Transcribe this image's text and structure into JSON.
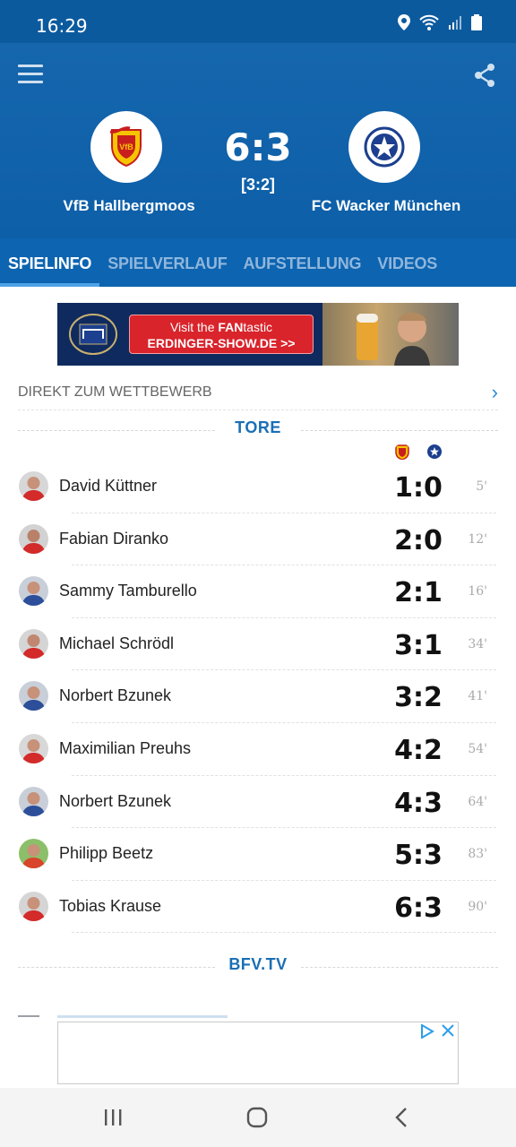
{
  "status_bar": {
    "time": "16:29"
  },
  "match": {
    "home_team": "VfB Hallbergmoos",
    "away_team": "FC Wacker München",
    "score": "6:3",
    "halftime": "[3:2]"
  },
  "tabs": [
    {
      "label": "SPIELINFO",
      "active": true
    },
    {
      "label": "SPIELVERLAUF",
      "active": false
    },
    {
      "label": "AUFSTELLUNG",
      "active": false
    },
    {
      "label": "VIDEOS",
      "active": false
    }
  ],
  "ad": {
    "line1_prefix": "Visit the ",
    "line1_bold": "FAN",
    "line1_suffix": "tastic",
    "line2": "ERDINGER-SHOW.DE >>"
  },
  "competition_link": "DIREKT ZUM WETTBEWERB",
  "goals_section": {
    "title": "TORE",
    "goals": [
      {
        "player": "David Küttner",
        "score": "1:0",
        "minute": "5'",
        "team": "home"
      },
      {
        "player": "Fabian Diranko",
        "score": "2:0",
        "minute": "12'",
        "team": "home"
      },
      {
        "player": "Sammy Tamburello",
        "score": "2:1",
        "minute": "16'",
        "team": "away"
      },
      {
        "player": "Michael Schrödl",
        "score": "3:1",
        "minute": "34'",
        "team": "home"
      },
      {
        "player": "Norbert Bzunek",
        "score": "3:2",
        "minute": "41'",
        "team": "away"
      },
      {
        "player": "Maximilian Preuhs",
        "score": "4:2",
        "minute": "54'",
        "team": "home"
      },
      {
        "player": "Norbert Bzunek",
        "score": "4:3",
        "minute": "64'",
        "team": "away"
      },
      {
        "player": "Philipp Beetz",
        "score": "5:3",
        "minute": "83'",
        "team": "home"
      },
      {
        "player": "Tobias Krause",
        "score": "6:3",
        "minute": "90'",
        "team": "home"
      }
    ]
  },
  "tv_section": {
    "title": "BFV.TV"
  },
  "colors": {
    "header_blue": "#0d5fa8",
    "accent_blue": "#1a6fb5",
    "home_red": "#d9242b",
    "away_navy": "#1c3f8f"
  }
}
